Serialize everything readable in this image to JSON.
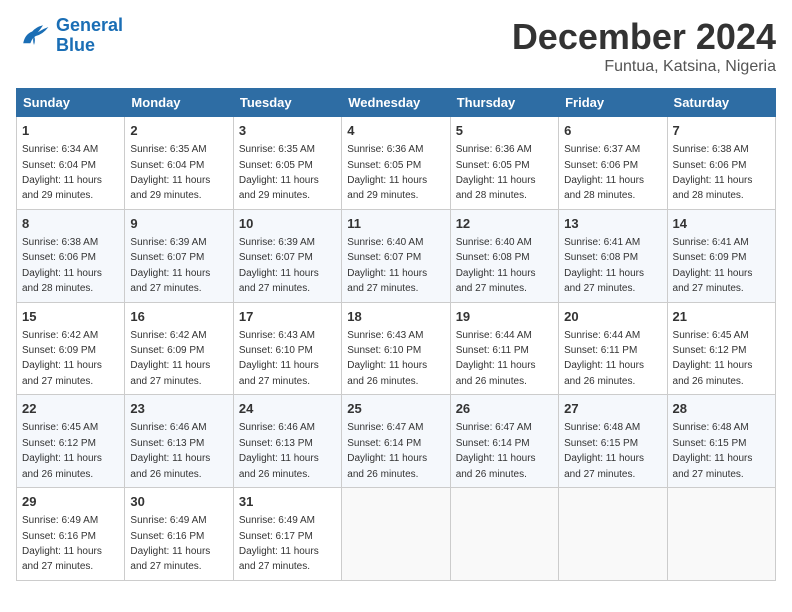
{
  "header": {
    "logo_line1": "General",
    "logo_line2": "Blue",
    "month": "December 2024",
    "location": "Funtua, Katsina, Nigeria"
  },
  "days_of_week": [
    "Sunday",
    "Monday",
    "Tuesday",
    "Wednesday",
    "Thursday",
    "Friday",
    "Saturday"
  ],
  "weeks": [
    [
      {
        "day": "1",
        "sunrise": "6:34 AM",
        "sunset": "6:04 PM",
        "daylight": "11 hours and 29 minutes."
      },
      {
        "day": "2",
        "sunrise": "6:35 AM",
        "sunset": "6:04 PM",
        "daylight": "11 hours and 29 minutes."
      },
      {
        "day": "3",
        "sunrise": "6:35 AM",
        "sunset": "6:05 PM",
        "daylight": "11 hours and 29 minutes."
      },
      {
        "day": "4",
        "sunrise": "6:36 AM",
        "sunset": "6:05 PM",
        "daylight": "11 hours and 29 minutes."
      },
      {
        "day": "5",
        "sunrise": "6:36 AM",
        "sunset": "6:05 PM",
        "daylight": "11 hours and 28 minutes."
      },
      {
        "day": "6",
        "sunrise": "6:37 AM",
        "sunset": "6:06 PM",
        "daylight": "11 hours and 28 minutes."
      },
      {
        "day": "7",
        "sunrise": "6:38 AM",
        "sunset": "6:06 PM",
        "daylight": "11 hours and 28 minutes."
      }
    ],
    [
      {
        "day": "8",
        "sunrise": "6:38 AM",
        "sunset": "6:06 PM",
        "daylight": "11 hours and 28 minutes."
      },
      {
        "day": "9",
        "sunrise": "6:39 AM",
        "sunset": "6:07 PM",
        "daylight": "11 hours and 27 minutes."
      },
      {
        "day": "10",
        "sunrise": "6:39 AM",
        "sunset": "6:07 PM",
        "daylight": "11 hours and 27 minutes."
      },
      {
        "day": "11",
        "sunrise": "6:40 AM",
        "sunset": "6:07 PM",
        "daylight": "11 hours and 27 minutes."
      },
      {
        "day": "12",
        "sunrise": "6:40 AM",
        "sunset": "6:08 PM",
        "daylight": "11 hours and 27 minutes."
      },
      {
        "day": "13",
        "sunrise": "6:41 AM",
        "sunset": "6:08 PM",
        "daylight": "11 hours and 27 minutes."
      },
      {
        "day": "14",
        "sunrise": "6:41 AM",
        "sunset": "6:09 PM",
        "daylight": "11 hours and 27 minutes."
      }
    ],
    [
      {
        "day": "15",
        "sunrise": "6:42 AM",
        "sunset": "6:09 PM",
        "daylight": "11 hours and 27 minutes."
      },
      {
        "day": "16",
        "sunrise": "6:42 AM",
        "sunset": "6:09 PM",
        "daylight": "11 hours and 27 minutes."
      },
      {
        "day": "17",
        "sunrise": "6:43 AM",
        "sunset": "6:10 PM",
        "daylight": "11 hours and 27 minutes."
      },
      {
        "day": "18",
        "sunrise": "6:43 AM",
        "sunset": "6:10 PM",
        "daylight": "11 hours and 26 minutes."
      },
      {
        "day": "19",
        "sunrise": "6:44 AM",
        "sunset": "6:11 PM",
        "daylight": "11 hours and 26 minutes."
      },
      {
        "day": "20",
        "sunrise": "6:44 AM",
        "sunset": "6:11 PM",
        "daylight": "11 hours and 26 minutes."
      },
      {
        "day": "21",
        "sunrise": "6:45 AM",
        "sunset": "6:12 PM",
        "daylight": "11 hours and 26 minutes."
      }
    ],
    [
      {
        "day": "22",
        "sunrise": "6:45 AM",
        "sunset": "6:12 PM",
        "daylight": "11 hours and 26 minutes."
      },
      {
        "day": "23",
        "sunrise": "6:46 AM",
        "sunset": "6:13 PM",
        "daylight": "11 hours and 26 minutes."
      },
      {
        "day": "24",
        "sunrise": "6:46 AM",
        "sunset": "6:13 PM",
        "daylight": "11 hours and 26 minutes."
      },
      {
        "day": "25",
        "sunrise": "6:47 AM",
        "sunset": "6:14 PM",
        "daylight": "11 hours and 26 minutes."
      },
      {
        "day": "26",
        "sunrise": "6:47 AM",
        "sunset": "6:14 PM",
        "daylight": "11 hours and 26 minutes."
      },
      {
        "day": "27",
        "sunrise": "6:48 AM",
        "sunset": "6:15 PM",
        "daylight": "11 hours and 27 minutes."
      },
      {
        "day": "28",
        "sunrise": "6:48 AM",
        "sunset": "6:15 PM",
        "daylight": "11 hours and 27 minutes."
      }
    ],
    [
      {
        "day": "29",
        "sunrise": "6:49 AM",
        "sunset": "6:16 PM",
        "daylight": "11 hours and 27 minutes."
      },
      {
        "day": "30",
        "sunrise": "6:49 AM",
        "sunset": "6:16 PM",
        "daylight": "11 hours and 27 minutes."
      },
      {
        "day": "31",
        "sunrise": "6:49 AM",
        "sunset": "6:17 PM",
        "daylight": "11 hours and 27 minutes."
      },
      null,
      null,
      null,
      null
    ]
  ]
}
